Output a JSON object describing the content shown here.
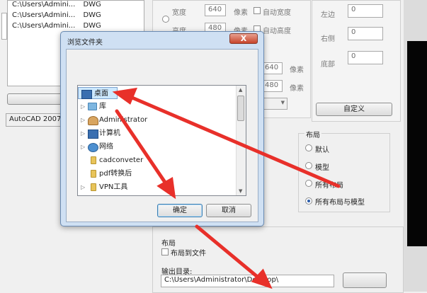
{
  "file_list": {
    "rows": [
      {
        "path": "C:\\Users\\Admini...",
        "type": "DWG"
      },
      {
        "path": "C:\\Users\\Admini...",
        "type": "DWG"
      },
      {
        "path": "C:\\Users\\Admini...",
        "type": "DWG"
      }
    ],
    "version_select": "AutoCAD 2007 D"
  },
  "size": {
    "width_label": "宽度",
    "width_value": "640",
    "width_unit": "像素",
    "auto_width": "自动宽度",
    "height_label": "高度",
    "height_value": "480",
    "height_unit": "像素",
    "auto_height": "自动高度",
    "width2_value": "640",
    "width2_unit": "像素",
    "height2_value": "480",
    "height2_unit": "像素"
  },
  "margins": {
    "left_label": "左边",
    "left_value": "0",
    "right_label": "右侧",
    "right_value": "0",
    "bottom_label": "底部",
    "bottom_value": "0",
    "custom_button": "自定义"
  },
  "layout": {
    "title": "布局",
    "options": [
      {
        "label": "默认",
        "selected": false
      },
      {
        "label": "模型",
        "selected": false
      },
      {
        "label": "所有布局",
        "selected": false
      },
      {
        "label": "所有布局与模型",
        "selected": true
      }
    ]
  },
  "layout_bottom": {
    "title": "布局",
    "to_file": "布局到文件"
  },
  "output": {
    "label": "输出目录:",
    "path": "C:\\Users\\Administrator\\Desktop\\"
  },
  "dialog": {
    "title": "浏览文件夹",
    "close": "X",
    "tree": [
      {
        "label": "桌面",
        "icon": "desktop-icon",
        "arrow": "",
        "selected": true
      },
      {
        "label": "库",
        "icon": "library-icon",
        "arrow": "▷",
        "selected": false
      },
      {
        "label": "Administrator",
        "icon": "user-icon",
        "arrow": "▷",
        "selected": false
      },
      {
        "label": "计算机",
        "icon": "computer-icon",
        "arrow": "▷",
        "selected": false
      },
      {
        "label": "网络",
        "icon": "network-icon",
        "arrow": "▷",
        "selected": false
      },
      {
        "label": "cadconveter",
        "icon": "folder-icon",
        "arrow": "",
        "selected": false
      },
      {
        "label": "pdf转换后",
        "icon": "folder-icon",
        "arrow": "",
        "selected": false
      },
      {
        "label": "VPN工具",
        "icon": "folder-icon",
        "arrow": "▷",
        "selected": false
      }
    ],
    "ok": "确定",
    "cancel": "取消"
  },
  "colors": {
    "annotation_arrow": "#e8302a",
    "dialog_frame": "#cfe0f3",
    "selection": "#cce8ff"
  }
}
